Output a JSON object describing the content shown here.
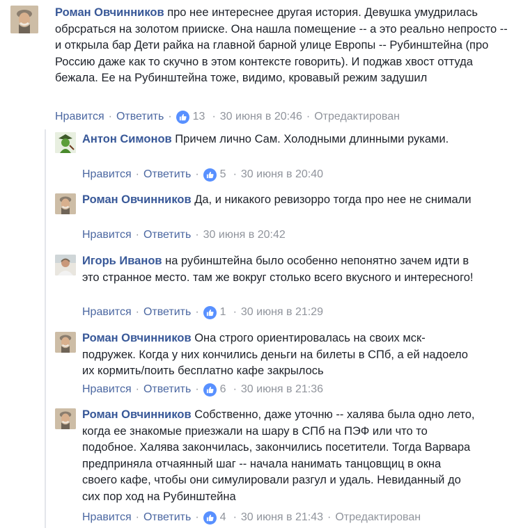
{
  "comments": [
    {
      "author": "Роман Овчинников",
      "text": "про нее интереснее другая история. Девушка умудрилась обрсраться на золотом прииске. Она нашла помещение -- а это реально непросто -- и открыла бар Дети райка на главной барной улице Европы -- Рубинштейна (про Россию даже как то скучно в этом контексте говорить). И поджав хвост оттуда бежала. Ее на Рубинштейна тоже, видимо, кровавый режим задушил",
      "like_label": "Нравится",
      "reply_label": "Ответить",
      "likes": "13",
      "time": "30 июня в 20:46",
      "edited": "Отредактирован",
      "avatar_icon": "man-portrait-avatar"
    },
    {
      "author": "Антон Симонов",
      "text": "Причем лично Сам. Холодными длинными руками.",
      "like_label": "Нравится",
      "reply_label": "Ответить",
      "likes": "5",
      "time": "30 июня в 20:40",
      "avatar_icon": "green-character-avatar"
    },
    {
      "author": "Роман Овчинников",
      "text": "Да, и никакого ревизорро тогда про нее не снимали",
      "like_label": "Нравится",
      "reply_label": "Ответить",
      "time": "30 июня в 20:42",
      "avatar_icon": "man-portrait-avatar"
    },
    {
      "author": "Игорь Иванов",
      "text": "на рубинштейна было особенно непонятно зачем идти в это странное место. там же вокруг столько всего вкусного и интересного!",
      "like_label": "Нравится",
      "reply_label": "Ответить",
      "likes": "1",
      "time": "30 июня в 21:29",
      "avatar_icon": "person-photo-avatar"
    },
    {
      "author": "Роман Овчинников",
      "text": "Она строго ориентировалась на своих мск-подружек. Когда у них кончились деньги на билеты в СПб, а ей надоело их кормить/поить бесплатно кафе закрылось",
      "like_label": "Нравится",
      "reply_label": "Ответить",
      "likes": "6",
      "time": "30 июня в 21:36",
      "avatar_icon": "man-portrait-avatar"
    },
    {
      "author": "Роман Овчинников",
      "text": "Собственно, даже уточню -- халява была одно лето, когда ее знакомые приезжали на шару в СПб на ПЭФ или что то подобное. Халява закончилась, закончились посетители. Тогда Варвара предприняла отчаянный шаг -- начала нанимать танцовщиц в окна своего кафе, чтобы они симулировали разгул и удаль. Невиданный до сих пор ход на Рубинштейна",
      "like_label": "Нравится",
      "reply_label": "Ответить",
      "likes": "4",
      "time": "30 июня в 21:43",
      "edited": "Отредактирован",
      "avatar_icon": "man-portrait-avatar"
    }
  ],
  "colors": {
    "author": "#385898",
    "link": "#4b67a1",
    "meta": "#90949c",
    "like_badge": "#5890ff",
    "text": "#1d2129"
  }
}
